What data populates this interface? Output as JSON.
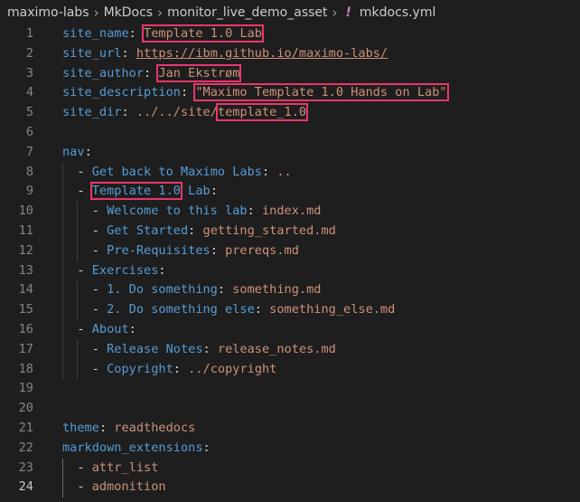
{
  "breadcrumb": {
    "items": [
      "maximo-labs",
      "MkDocs",
      "monitor_live_demo_asset"
    ],
    "file_icon": "!",
    "file": "mkdocs.yml"
  },
  "editor": {
    "lines": [
      {
        "n": "1",
        "segs": [
          [
            "k",
            "site_name"
          ],
          [
            "p",
            ": "
          ],
          [
            "s",
            "Template 1.0 Lab",
            "box"
          ]
        ]
      },
      {
        "n": "2",
        "segs": [
          [
            "k",
            "site_url"
          ],
          [
            "p",
            ": "
          ],
          [
            "u",
            "https://ibm.github.io/maximo-labs/"
          ]
        ]
      },
      {
        "n": "3",
        "segs": [
          [
            "k",
            "site_author"
          ],
          [
            "p",
            ": "
          ],
          [
            "s",
            "Jan Ekstrøm",
            "box"
          ]
        ]
      },
      {
        "n": "4",
        "segs": [
          [
            "k",
            "site_description"
          ],
          [
            "p",
            ": "
          ],
          [
            "s",
            "\"Maximo Template 1.0 Hands on Lab\"",
            "box"
          ]
        ]
      },
      {
        "n": "5",
        "segs": [
          [
            "k",
            "site_dir"
          ],
          [
            "p",
            ": "
          ],
          [
            "s",
            "../../site/"
          ],
          [
            "s",
            "template_1.0",
            "box"
          ]
        ]
      },
      {
        "n": "6",
        "segs": []
      },
      {
        "n": "7",
        "segs": [
          [
            "k",
            "nav"
          ],
          [
            "p",
            ":"
          ]
        ]
      },
      {
        "n": "8",
        "segs": [
          [
            "p",
            "  - "
          ],
          [
            "k",
            "Get back to Maximo Labs"
          ],
          [
            "p",
            ": "
          ],
          [
            "s",
            ".."
          ]
        ]
      },
      {
        "n": "9",
        "segs": [
          [
            "p",
            "  - "
          ],
          [
            "k",
            "Template 1.0",
            "box"
          ],
          [
            "k",
            " Lab"
          ],
          [
            "p",
            ":"
          ]
        ]
      },
      {
        "n": "10",
        "segs": [
          [
            "p",
            "    - "
          ],
          [
            "k",
            "Welcome to this lab"
          ],
          [
            "p",
            ": "
          ],
          [
            "s",
            "index.md"
          ]
        ]
      },
      {
        "n": "11",
        "segs": [
          [
            "p",
            "    - "
          ],
          [
            "k",
            "Get Started"
          ],
          [
            "p",
            ": "
          ],
          [
            "s",
            "getting_started.md"
          ]
        ]
      },
      {
        "n": "12",
        "segs": [
          [
            "p",
            "    - "
          ],
          [
            "k",
            "Pre-Requisites"
          ],
          [
            "p",
            ": "
          ],
          [
            "s",
            "prereqs.md"
          ]
        ]
      },
      {
        "n": "13",
        "segs": [
          [
            "p",
            "  - "
          ],
          [
            "k",
            "Exercises"
          ],
          [
            "p",
            ":"
          ]
        ]
      },
      {
        "n": "14",
        "segs": [
          [
            "p",
            "    - "
          ],
          [
            "k",
            "1. Do something"
          ],
          [
            "p",
            ": "
          ],
          [
            "s",
            "something.md"
          ]
        ]
      },
      {
        "n": "15",
        "segs": [
          [
            "p",
            "    - "
          ],
          [
            "k",
            "2. Do something else"
          ],
          [
            "p",
            ": "
          ],
          [
            "s",
            "something_else.md"
          ]
        ]
      },
      {
        "n": "16",
        "segs": [
          [
            "p",
            "  - "
          ],
          [
            "k",
            "About"
          ],
          [
            "p",
            ":"
          ]
        ]
      },
      {
        "n": "17",
        "segs": [
          [
            "p",
            "    - "
          ],
          [
            "k",
            "Release Notes"
          ],
          [
            "p",
            ": "
          ],
          [
            "s",
            "release_notes.md"
          ]
        ]
      },
      {
        "n": "18",
        "segs": [
          [
            "p",
            "    - "
          ],
          [
            "k",
            "Copyright"
          ],
          [
            "p",
            ": "
          ],
          [
            "s",
            "../copyright"
          ]
        ]
      },
      {
        "n": "19",
        "segs": []
      },
      {
        "n": "20",
        "segs": []
      },
      {
        "n": "21",
        "segs": [
          [
            "k",
            "theme"
          ],
          [
            "p",
            ": "
          ],
          [
            "s",
            "readthedocs"
          ]
        ]
      },
      {
        "n": "22",
        "segs": [
          [
            "k",
            "markdown_extensions"
          ],
          [
            "p",
            ":"
          ]
        ]
      },
      {
        "n": "23",
        "segs": [
          [
            "p",
            "  - "
          ],
          [
            "s",
            "attr_list"
          ]
        ]
      },
      {
        "n": "24",
        "segs": [
          [
            "p",
            "  - "
          ],
          [
            "s",
            "admonition"
          ]
        ],
        "active": true
      }
    ]
  },
  "colors": {
    "background": "#1e1e1e",
    "key": "#569cd6",
    "string": "#ce9178",
    "punctuation": "#d4d4d4",
    "line_number": "#858585",
    "highlight_box": "#e8376d"
  }
}
